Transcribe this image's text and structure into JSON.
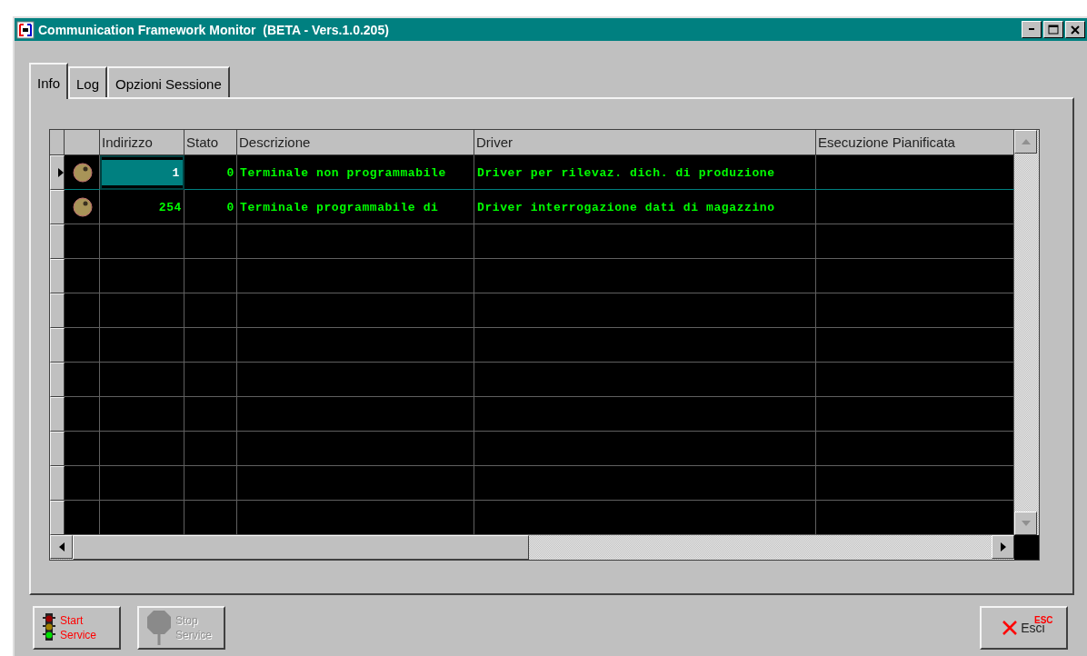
{
  "window": {
    "title": "Communication Framework Monitor  (BETA - Vers.1.0.205)"
  },
  "tabs": [
    {
      "label": "Info",
      "selected": true
    },
    {
      "label": "Log",
      "selected": false
    },
    {
      "label": "Opzioni Sessione",
      "selected": false
    }
  ],
  "table": {
    "columns": [
      "Indirizzo",
      "Stato",
      "Descrizione",
      "Driver",
      "Esecuzione Pianificata"
    ],
    "rows": [
      {
        "selected": true,
        "cells": [
          "1",
          "0",
          "Terminale non programmabile",
          "Driver per rilevaz. dich. di produzione",
          ""
        ]
      },
      {
        "selected": false,
        "cells": [
          "254",
          "0",
          "Terminale programmabile di",
          "Driver interrogazione dati di magazzino",
          ""
        ]
      }
    ]
  },
  "buttons": [
    {
      "kind": "start",
      "label": "Start Service",
      "disabled": false
    },
    {
      "kind": "stop",
      "label": "Stop Service",
      "disabled": true
    },
    {
      "kind": "exit",
      "label": "Esci",
      "hotkey": "ESC",
      "disabled": false
    }
  ]
}
